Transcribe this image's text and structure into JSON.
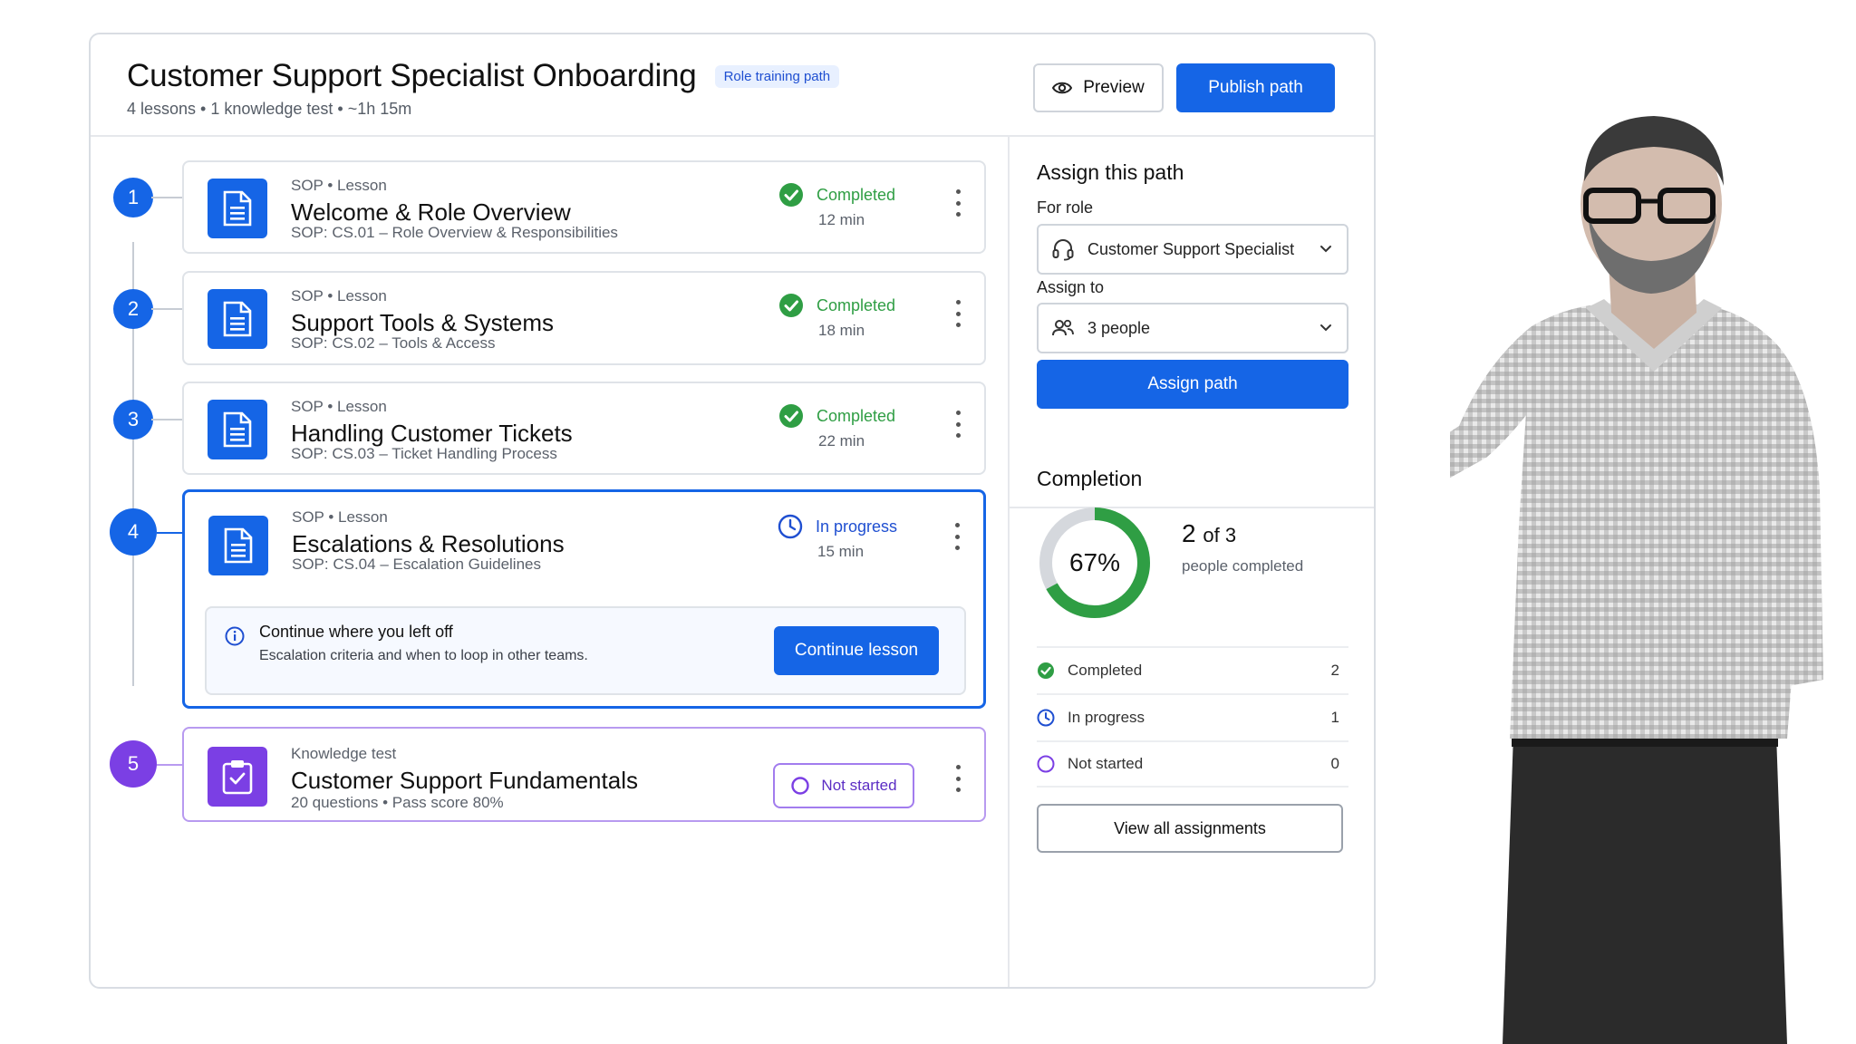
{
  "header": {
    "title": "Customer Support Specialist Onboarding",
    "badge": "Role training path",
    "subtitle": "4 lessons • 1 knowledge test • ~1h 15m",
    "preview_label": "Preview",
    "publish_label": "Publish path"
  },
  "steps": [
    {
      "number": "1",
      "kicker": "SOP • Lesson",
      "title": "Welcome & Role Overview",
      "meta": "SOP: CS.01 – Role Overview & Responsibilities",
      "status": "Completed",
      "duration": "12 min"
    },
    {
      "number": "2",
      "kicker": "SOP • Lesson",
      "title": "Support Tools & Systems",
      "meta": "SOP: CS.02 – Tools & Access",
      "status": "Completed",
      "duration": "18 min"
    },
    {
      "number": "3",
      "kicker": "SOP • Lesson",
      "title": "Handling Customer Tickets",
      "meta": "SOP: CS.03 – Ticket Handling Process",
      "status": "Completed",
      "duration": "22 min"
    },
    {
      "number": "4",
      "kicker": "SOP • Lesson",
      "title": "Escalations & Resolutions",
      "meta": "SOP: CS.04 – Escalation Guidelines",
      "status": "In progress",
      "duration": "15 min",
      "continue": {
        "title": "Continue where you left off",
        "subtitle": "Escalation criteria and when to loop in other teams.",
        "button": "Continue lesson"
      }
    },
    {
      "number": "5",
      "kicker": "Knowledge test",
      "title": "Customer Support Fundamentals",
      "meta": "20 questions  •  Pass score 80%",
      "status": "Not started"
    }
  ],
  "assign": {
    "title": "Assign this path",
    "role_label": "For role",
    "role_value": "Customer Support Specialist",
    "assign_to_label": "Assign to",
    "assign_to_value": "3 people",
    "button": "Assign path"
  },
  "completion": {
    "title": "Completion",
    "percent": 67,
    "percent_label": "67%",
    "count": "2",
    "of_total": "of 3",
    "caption": "people completed",
    "rows": [
      {
        "label": "Completed",
        "value": "2"
      },
      {
        "label": "In progress",
        "value": "1"
      },
      {
        "label": "Not started",
        "value": "0"
      }
    ],
    "view_all": "View all assignments"
  },
  "colors": {
    "primary": "#1565e6",
    "success": "#2f9e44",
    "purple": "#7b3fe4",
    "border": "#dfe3e8"
  }
}
